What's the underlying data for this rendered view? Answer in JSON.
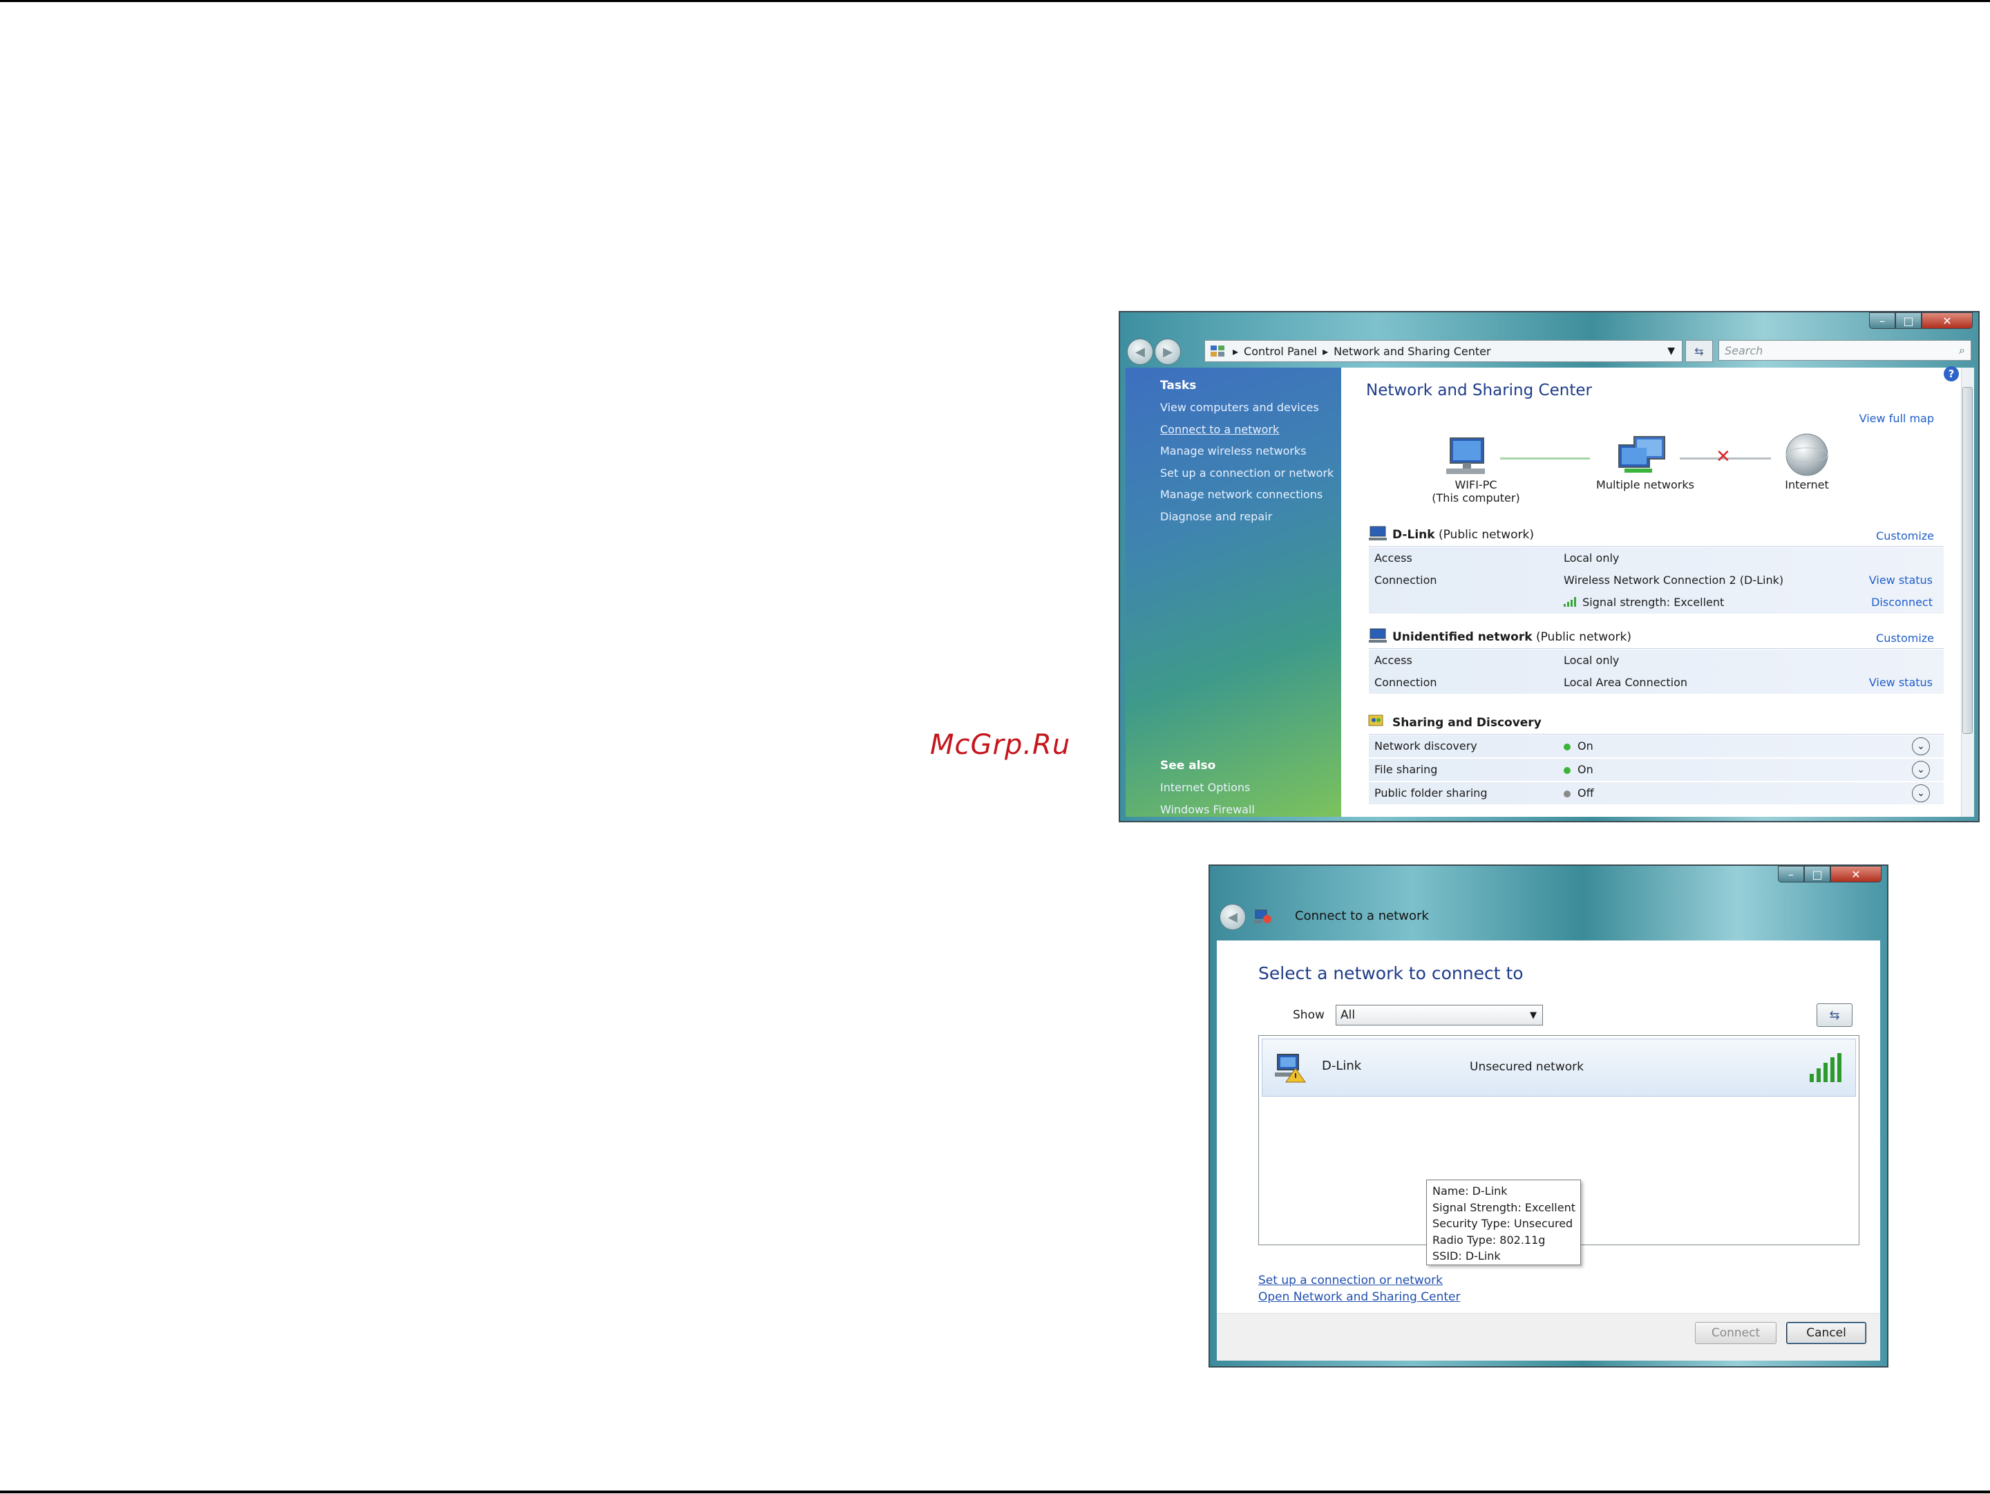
{
  "watermark": "McGrp.Ru",
  "window1": {
    "address": {
      "segments": [
        "Control Panel",
        "Network and Sharing Center"
      ]
    },
    "search_placeholder": "Search",
    "sidebar": {
      "tasks_heading": "Tasks",
      "tasks": [
        "View computers and devices",
        "Connect to a network",
        "Manage wireless networks",
        "Set up a connection or network",
        "Manage network connections",
        "Diagnose and repair"
      ],
      "see_also_heading": "See also",
      "see_also": [
        "Internet Options",
        "Windows Firewall"
      ]
    },
    "title": "Network and Sharing Center",
    "view_full_map": "View full map",
    "map": {
      "computer": "WIFI-PC",
      "computer_sub": "(This computer)",
      "networks": "Multiple networks",
      "internet": "Internet"
    },
    "dlink": {
      "name": "D-Link",
      "type": "(Public network)",
      "customize": "Customize",
      "access_label": "Access",
      "access_value": "Local only",
      "connection_label": "Connection",
      "connection_value": "Wireless Network Connection 2 (D-Link)",
      "view_status": "View status",
      "signal": "Signal strength:  Excellent",
      "disconnect": "Disconnect"
    },
    "unidentified": {
      "name": "Unidentified network",
      "type": "(Public network)",
      "customize": "Customize",
      "access_label": "Access",
      "access_value": "Local only",
      "connection_label": "Connection",
      "connection_value": "Local Area Connection",
      "view_status": "View status"
    },
    "sharing": {
      "heading": "Sharing and Discovery",
      "items": [
        {
          "label": "Network discovery",
          "state": "On",
          "color": "#3cb43c"
        },
        {
          "label": "File sharing",
          "state": "On",
          "color": "#3cb43c"
        },
        {
          "label": "Public folder sharing",
          "state": "Off",
          "color": "#8a8a8a"
        }
      ]
    }
  },
  "window2": {
    "title": "Connect to a network",
    "heading": "Select a network to connect to",
    "show_label": "Show",
    "show_value": "All",
    "network": {
      "name": "D-Link",
      "status": "Unsecured network"
    },
    "tooltip": [
      "Name: D-Link",
      "Signal Strength: Excellent",
      "Security Type: Unsecured",
      "Radio Type: 802.11g",
      "SSID: D-Link"
    ],
    "links": [
      "Set up a connection or network",
      "Open Network and Sharing Center"
    ],
    "connect": "Connect",
    "cancel": "Cancel"
  },
  "colors": {
    "accent_link": "#1f5ec9",
    "title_blue": "#1e3c8a",
    "status_on": "#3cb43c",
    "disconnected_x": "#d9262b"
  }
}
